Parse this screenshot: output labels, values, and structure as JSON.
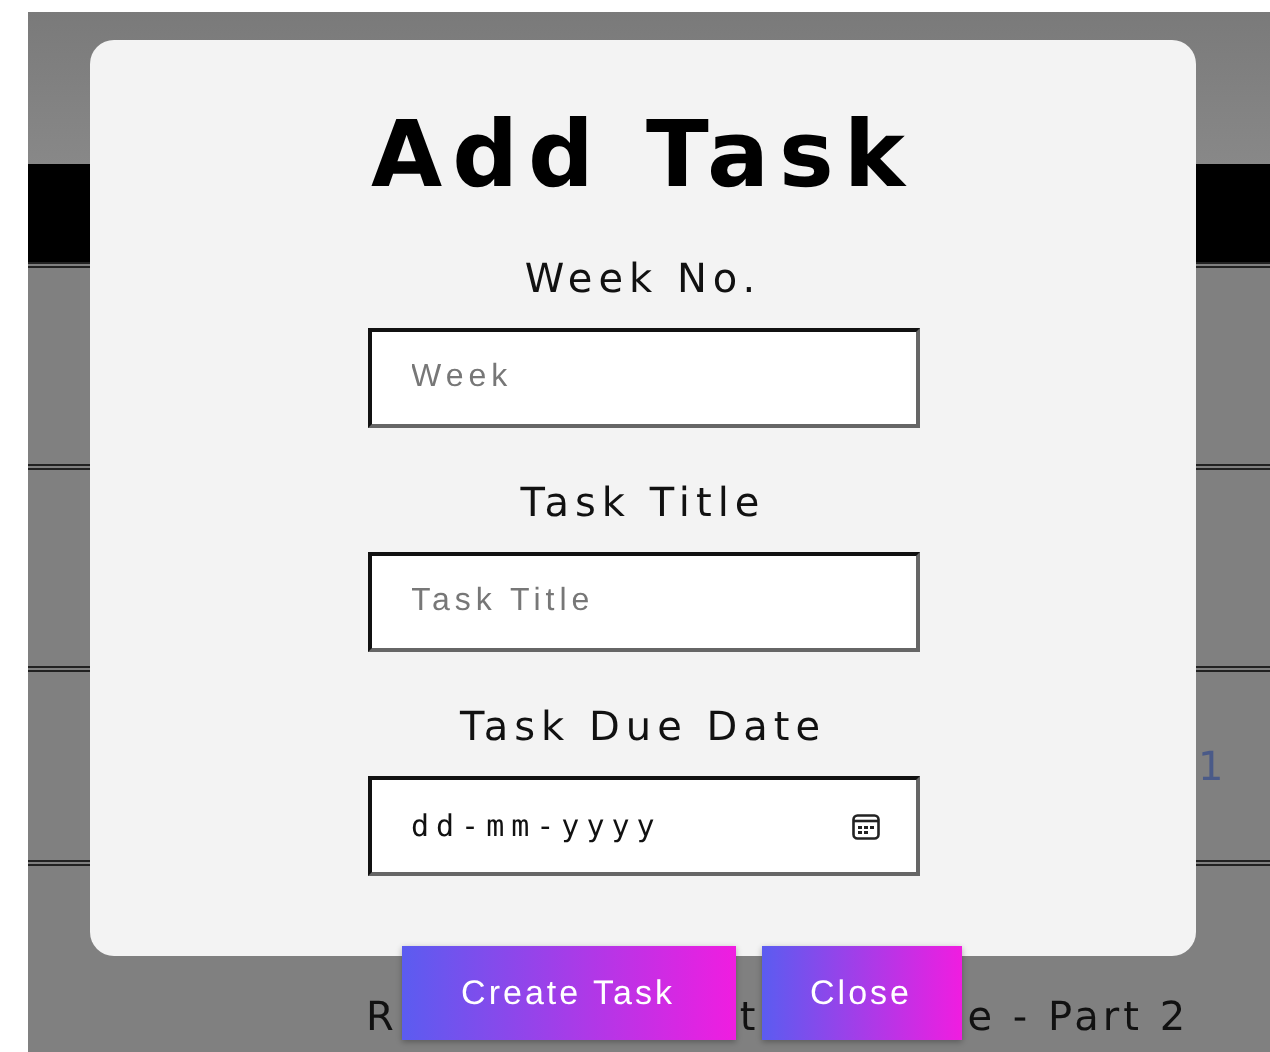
{
  "background_table": {
    "rows": [
      {
        "cells": []
      },
      {
        "cells": []
      },
      {
        "cells": [
          {
            "text": "1",
            "kind": "link"
          }
        ]
      },
      {
        "cells": [
          {
            "text": "R",
            "kind": "plain"
          },
          {
            "text": "t",
            "kind": "plain"
          },
          {
            "text": "e - Part 2",
            "kind": "plain"
          }
        ]
      }
    ]
  },
  "dialog": {
    "title": "Add Task",
    "fields": [
      {
        "label": "Week No.",
        "placeholder": "Week",
        "kind": "text"
      },
      {
        "label": "Task Title",
        "placeholder": "Task Title",
        "kind": "text"
      },
      {
        "label": "Task Due Date",
        "placeholder": "dd-mm-yyyy",
        "kind": "date"
      }
    ],
    "buttons": [
      "Create Task",
      "Close"
    ]
  }
}
